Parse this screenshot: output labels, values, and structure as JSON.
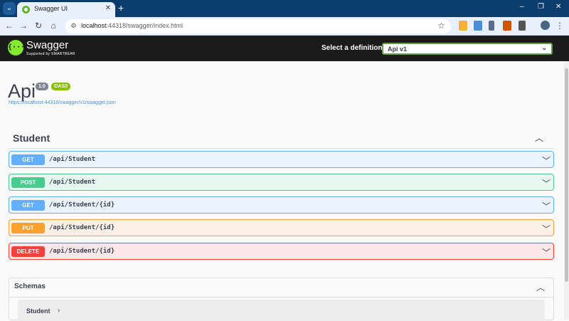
{
  "browser": {
    "tab_title": "Swagger UI",
    "tab_close": "✕",
    "new_tab": "+",
    "url_host": "localhost",
    "url_path": ":44318/swagger/index.html",
    "window_controls": [
      "–",
      "❐",
      "✕"
    ]
  },
  "header": {
    "brand": "Swagger",
    "brand_sub": "Supported by SMARTBEAR",
    "definition_label": "Select a definition",
    "definition_value": "Api v1"
  },
  "info": {
    "title": "Api",
    "version": "1.0",
    "oas": "OAS3",
    "spec_url": "https://localhost:44318/swagger/v1/swagger.json"
  },
  "tag": {
    "name": "Student"
  },
  "operations": [
    {
      "method": "GET",
      "path": "/api/Student"
    },
    {
      "method": "POST",
      "path": "/api/Student"
    },
    {
      "method": "GET",
      "path": "/api/Student/{id}"
    },
    {
      "method": "PUT",
      "path": "/api/Student/{id}"
    },
    {
      "method": "DELETE",
      "path": "/api/Student/{id}"
    }
  ],
  "schemas": {
    "title": "Schemas",
    "models": [
      "Student"
    ]
  },
  "colors": {
    "get": "#61affe",
    "post": "#49cc90",
    "put": "#fca130",
    "delete": "#f93e3e",
    "swagger_green": "#85ea2d",
    "header_bg": "#1b1b1b"
  }
}
